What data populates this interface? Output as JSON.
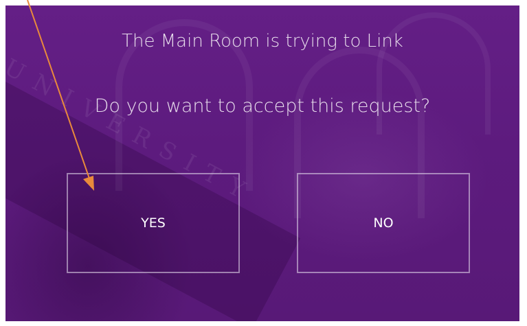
{
  "dialog": {
    "title": "The Main Room is trying to Link",
    "question": "Do you want to accept this request?",
    "yes_label": "YES",
    "no_label": "NO"
  },
  "background": {
    "motto": "UNIVERSITY"
  },
  "colors": {
    "panel": "#5f1f7f",
    "text": "#e7dceb",
    "button_border": "#d8cadf",
    "annotation_arrow": "#e98a3c"
  },
  "icons": {
    "annotation": "arrow-pointer-icon"
  }
}
